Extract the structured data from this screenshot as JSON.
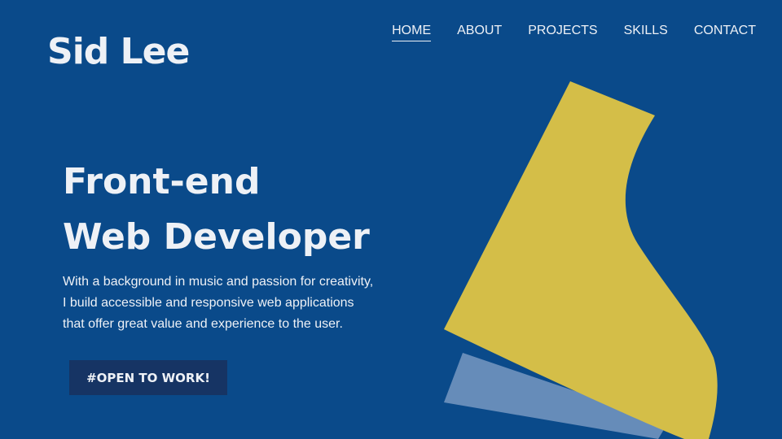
{
  "brand": {
    "name": "Sid Lee"
  },
  "nav": {
    "items": [
      {
        "label": "HOME",
        "active": true
      },
      {
        "label": "ABOUT",
        "active": false
      },
      {
        "label": "PROJECTS",
        "active": false
      },
      {
        "label": "SKILLS",
        "active": false
      },
      {
        "label": "CONTACT",
        "active": false
      }
    ]
  },
  "hero": {
    "title_line1": "Front-end",
    "title_line2": "Web Developer",
    "description_lines": [
      "With a background in music and passion for creativity,",
      "I build accessible and responsive web applications",
      "that offer great value and experience to the user."
    ],
    "cta_label": "#OPEN TO WORK!"
  },
  "colors": {
    "background": "#0a4a8a",
    "text": "#eef1f6",
    "cta_background": "#163464",
    "shape_yellow": "#d4be48",
    "shape_light_blue": "#6b8fbc"
  }
}
